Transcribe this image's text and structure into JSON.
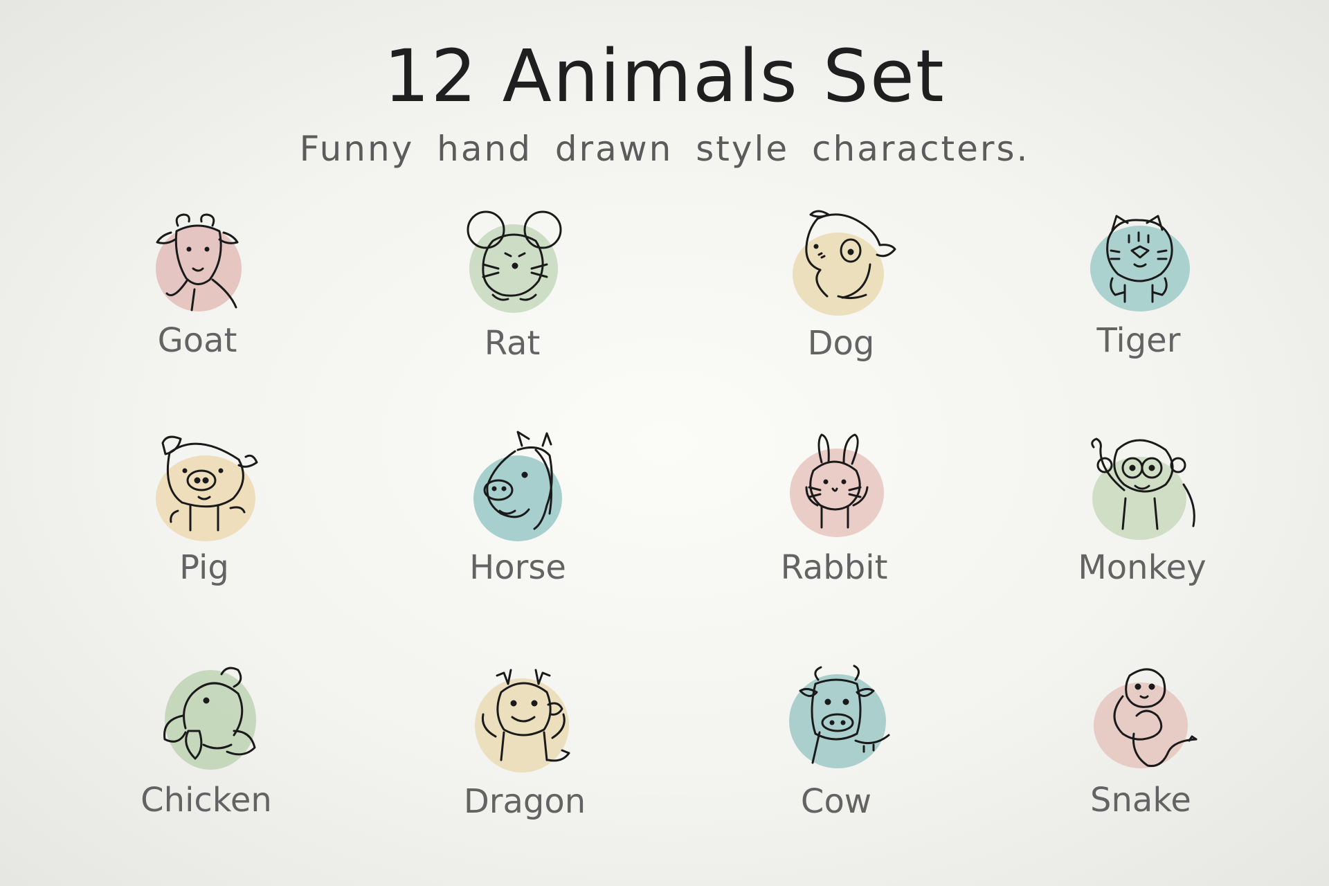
{
  "header": {
    "title": "12 Animals Set",
    "subtitle": "Funny hand drawn style characters."
  },
  "animals": [
    {
      "label": "Goat",
      "color": "#e2bdb8",
      "icon": "goat-icon"
    },
    {
      "label": "Rat",
      "color": "#c6d8bd",
      "icon": "rat-icon"
    },
    {
      "label": "Dog",
      "color": "#eadbb3",
      "icon": "dog-icon"
    },
    {
      "label": "Tiger",
      "color": "#9fcbc9",
      "icon": "tiger-icon"
    },
    {
      "label": "Pig",
      "color": "#ecd9b3",
      "icon": "pig-icon"
    },
    {
      "label": "Horse",
      "color": "#99c8c6",
      "icon": "horse-icon"
    },
    {
      "label": "Rabbit",
      "color": "#e8c6be",
      "icon": "rabbit-icon"
    },
    {
      "label": "Monkey",
      "color": "#c8d9bd",
      "icon": "monkey-icon"
    },
    {
      "label": "Chicken",
      "color": "#bed3b4",
      "icon": "chicken-icon"
    },
    {
      "label": "Dragon",
      "color": "#eadbb5",
      "icon": "dragon-icon"
    },
    {
      "label": "Cow",
      "color": "#9cc8c5",
      "icon": "cow-icon"
    },
    {
      "label": "Snake",
      "color": "#e5c6bf",
      "icon": "snake-icon"
    }
  ]
}
